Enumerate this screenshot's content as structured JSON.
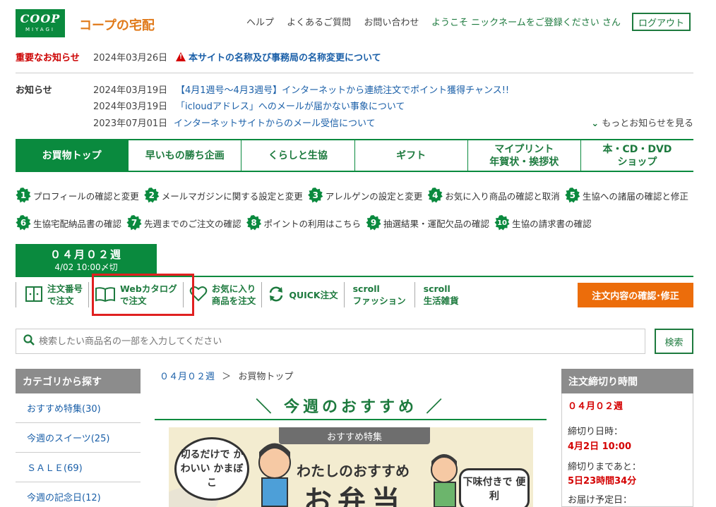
{
  "header": {
    "logo_main": "COOP",
    "logo_sub": "MIYAGI",
    "site_title": "コープの宅配",
    "links": [
      "ヘルプ",
      "よくあるご質問",
      "お問い合わせ"
    ],
    "welcome": "ようこそ ニックネームをご登録ください さん",
    "logout": "ログアウト"
  },
  "important_notice": {
    "label": "重要なお知らせ",
    "date": "2024年03月26日",
    "text": "本サイトの名称及び事務局の名称変更について"
  },
  "notices": {
    "label": "お知らせ",
    "items": [
      {
        "date": "2024年03月19日",
        "text": "【4月1週号～4月3週号】インターネットから連続注文でポイント獲得チャンス!!"
      },
      {
        "date": "2024年03月19日",
        "text": "「icloudアドレス」へのメールが届かない事象について"
      },
      {
        "date": "2023年07月01日",
        "text": "インターネットサイトからのメール受信について"
      }
    ],
    "more": "もっとお知らせを見る"
  },
  "main_nav": [
    {
      "line1": "お買物トップ",
      "line2": ""
    },
    {
      "line1": "早いもの勝ち企画",
      "line2": ""
    },
    {
      "line1": "くらしと生協",
      "line2": ""
    },
    {
      "line1": "ギフト",
      "line2": ""
    },
    {
      "line1": "マイプリント",
      "line2": "年賀状・挨拶状"
    },
    {
      "line1": "本・CD・DVD",
      "line2": "ショップ"
    }
  ],
  "numbered_links": [
    {
      "num": "1",
      "label": "プロフィールの確認と変更"
    },
    {
      "num": "2",
      "label": "メールマガジンに関する設定と変更"
    },
    {
      "num": "3",
      "label": "アレルゲンの設定と変更"
    },
    {
      "num": "4",
      "label": "お気に入り商品の確認と取消"
    },
    {
      "num": "5",
      "label": "生協への諸届の確認と修正"
    },
    {
      "num": "6",
      "label": "生協宅配納品書の確認"
    },
    {
      "num": "7",
      "label": "先週までのご注文の確認"
    },
    {
      "num": "8",
      "label": "ポイントの利用はこちら"
    },
    {
      "num": "9",
      "label": "抽選結果・運配欠品の確認"
    },
    {
      "num": "10",
      "label": "生協の請求書の確認"
    }
  ],
  "week_tab": {
    "week": "０４月０２週",
    "deadline": "4/02 10:00〆切"
  },
  "toolbar": [
    {
      "icon": "book-columns-icon",
      "line1": "注文番号",
      "line2": "で注文"
    },
    {
      "icon": "open-book-icon",
      "line1": "Webカタログ",
      "line2": "で注文"
    },
    {
      "icon": "heart-icon",
      "line1": "お気に入り",
      "line2": "商品を注文"
    },
    {
      "icon": "refresh-icon",
      "line1": "QUICK注文",
      "line2": ""
    },
    {
      "icon": "",
      "line1": "scroll",
      "line2": "ファッション"
    },
    {
      "icon": "",
      "line1": "scroll",
      "line2": "生活雑貨"
    }
  ],
  "confirm_button": "注文内容の確認･修正",
  "search": {
    "placeholder": "検索したい商品名の一部を入力してください",
    "button": "検索"
  },
  "category": {
    "title": "カテゴリから探す",
    "items": [
      "おすすめ特集(30)",
      "今週のスイーツ(25)",
      "ＳＡＬＥ(69)",
      "今週の記念日(12)"
    ]
  },
  "breadcrumb": {
    "week": "０４月０２週",
    "sep": "＞",
    "current": "お買物トップ"
  },
  "recommend": {
    "title": "＼ 今週のおすすめ ／",
    "banner_tag": "おすすめ特集",
    "bubble_left": "切るだけで かわいい かまぼこ",
    "banner_main": "わたしのおすすめ",
    "banner_big": "お弁当",
    "bubble_right": "下味付きで 便利"
  },
  "deadline_panel": {
    "title": "注文締切り時間",
    "week": "０４月０２週",
    "deadline_label": "締切り日時：",
    "deadline_value": "4月2日 10:00",
    "remaining_label": "締切りまであと：",
    "remaining_value": "5日23時間34分",
    "delivery_label": "お届け予定日："
  },
  "colors": {
    "brand_green": "#0a8a3e",
    "accent_orange": "#ec6d0b",
    "alert_red": "#d40000",
    "link_blue": "#1a5fa8"
  }
}
